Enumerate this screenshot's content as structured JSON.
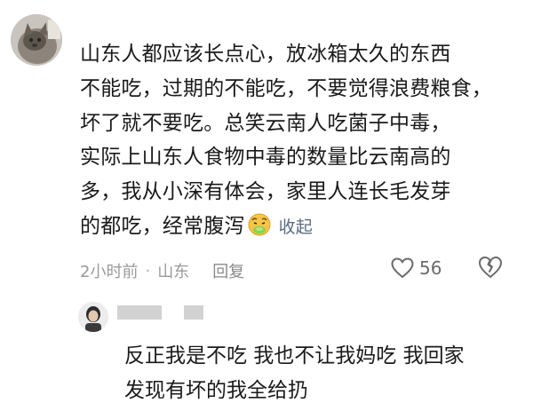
{
  "comment": {
    "lines": [
      "山东人都应该长点心，放冰箱太久的东西",
      "不能吃，过期的不能吃，不要觉得浪费粮食，",
      "坏了就不要吃。总笑云南人吃菌子中毒，",
      "实际上山东人食物中毒的数量比云南高的",
      "多，我从小深有体会，家里人连长毛发芽",
      "的都吃，经常腹泻"
    ],
    "emoji_icon": "sick-face-emoji",
    "collapse_label": "收起",
    "time": "2小时前",
    "separator": "·",
    "location": "山东",
    "reply_label": "回复",
    "like_count": "56"
  },
  "reply": {
    "lines": [
      "反正我是不吃 我也不让我妈吃 我回家",
      "发现有坏的我全给扔"
    ]
  },
  "colors": {
    "text": "#1a1a1a",
    "meta": "#9a9a9a",
    "link": "#5c6b80",
    "redaction": "#d2d2d2"
  }
}
